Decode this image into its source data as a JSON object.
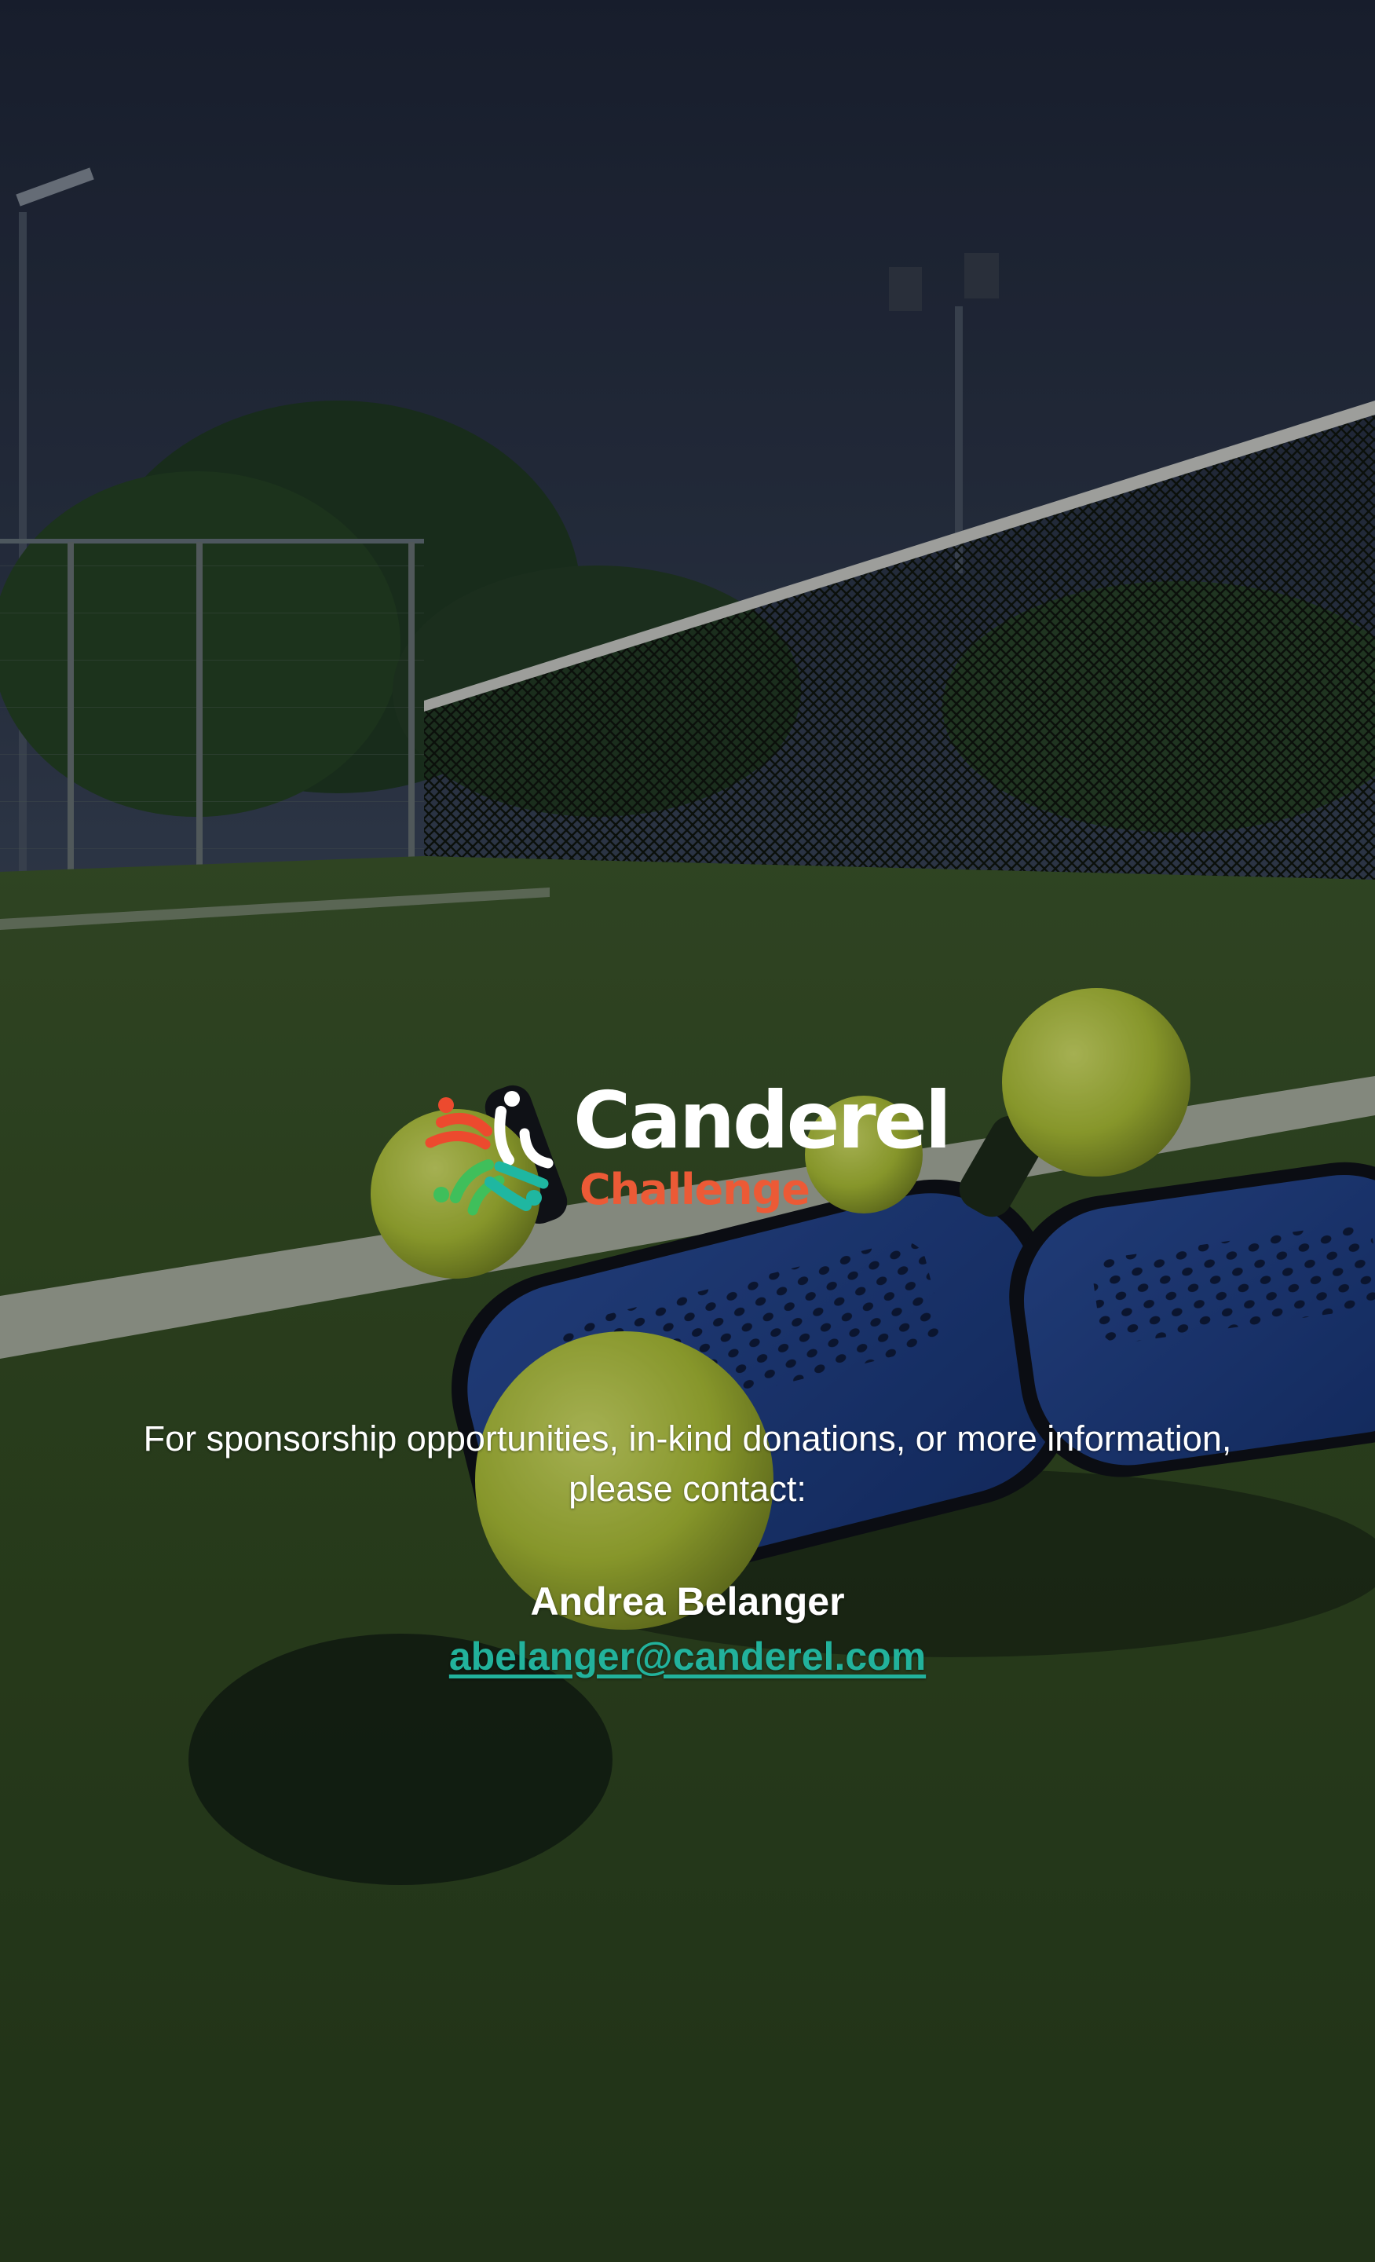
{
  "brand": {
    "name": "Canderel",
    "subtitle": "Challenge",
    "colors": {
      "primary_text": "#ffffff",
      "subtitle": "#ec5a36",
      "mark_red": "#ec4a2e",
      "mark_green": "#3fbf5b",
      "mark_teal": "#1fb7a1",
      "link": "#22b29c"
    }
  },
  "message": {
    "line1": "For sponsorship opportunities, in-kind donations, or more information,",
    "line2": "please contact:"
  },
  "contact": {
    "name": "Andrea Belanger",
    "email": "abelanger@canderel.com"
  }
}
